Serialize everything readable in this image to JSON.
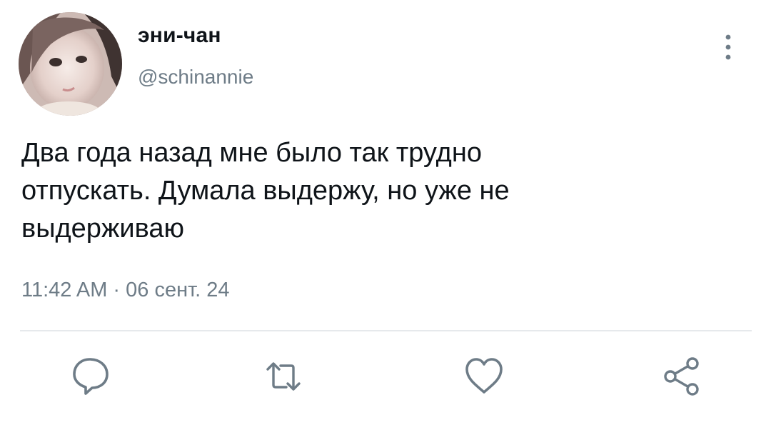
{
  "tweet": {
    "display_name": "эни-чан",
    "handle": "@schinannie",
    "text": "Два года назад мне было так трудно\nотпускать. Думала выдержу, но уже не\nвыдерживаю",
    "timestamp": "11:42 AM · 06 сент. 24"
  },
  "actions": [
    {
      "name": "reply",
      "icon": "reply-icon"
    },
    {
      "name": "retweet",
      "icon": "retweet-icon"
    },
    {
      "name": "like",
      "icon": "heart-icon"
    },
    {
      "name": "share",
      "icon": "share-icon"
    }
  ],
  "colors": {
    "text_primary": "#0f1419",
    "text_secondary": "#6e7c87",
    "icon": "#6e7c87",
    "divider": "#e6e9ec"
  }
}
